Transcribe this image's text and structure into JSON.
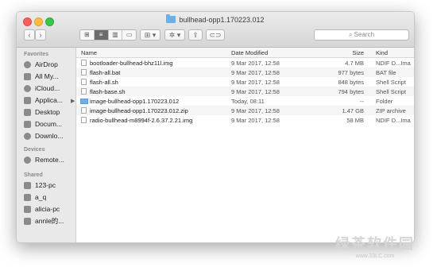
{
  "window": {
    "title": "bullhead-opp1.170223.012"
  },
  "toolbar": {
    "back": "‹",
    "forward": "›",
    "view_modes": [
      "⊞",
      "≡",
      "▥",
      "▭"
    ],
    "arrange": "⊞ ▾",
    "action": "✲ ▾",
    "share": "⇪",
    "tags": "⊂⊃",
    "search_placeholder": "Search"
  },
  "sidebar": {
    "favorites_header": "Favorites",
    "favorites": [
      "AirDrop",
      "All My...",
      "iCloud...",
      "Applica...",
      "Desktop",
      "Docum...",
      "Downlo..."
    ],
    "devices_header": "Devices",
    "devices": [
      "Remote..."
    ],
    "shared_header": "Shared",
    "shared": [
      "123-pc",
      "a_q",
      "alicia-pc",
      "annle的..."
    ]
  },
  "columns": {
    "name": "Name",
    "date": "Date Modified",
    "size": "Size",
    "kind": "Kind"
  },
  "files": [
    {
      "name": "bootloader-bullhead-bhz11l.img",
      "date": "9 Mar 2017, 12:58",
      "size": "4.7 MB",
      "kind": "NDIF D...Ima",
      "type": "file"
    },
    {
      "name": "flash-all.bat",
      "date": "9 Mar 2017, 12:58",
      "size": "977 bytes",
      "kind": "BAT file",
      "type": "file"
    },
    {
      "name": "flash-all.sh",
      "date": "9 Mar 2017, 12:58",
      "size": "848 bytes",
      "kind": "Shell Script",
      "type": "file"
    },
    {
      "name": "flash-base.sh",
      "date": "9 Mar 2017, 12:58",
      "size": "794 bytes",
      "kind": "Shell Script",
      "type": "file"
    },
    {
      "name": "image-bullhead-opp1.170223.012",
      "date": "Today, 08:11",
      "size": "--",
      "kind": "Folder",
      "type": "folder"
    },
    {
      "name": "image-bullhead-opp1.170223.012.zip",
      "date": "9 Mar 2017, 12:58",
      "size": "1.47 GB",
      "kind": "ZIP archive",
      "type": "file"
    },
    {
      "name": "radio-bullhead-m8994f-2.6.37.2.21.img",
      "date": "9 Mar 2017, 12:58",
      "size": "58 MB",
      "kind": "NDIF D...Ima",
      "type": "file"
    }
  ],
  "watermark": {
    "line1": "绿茶软件园",
    "line2": "www.33LC.com"
  }
}
